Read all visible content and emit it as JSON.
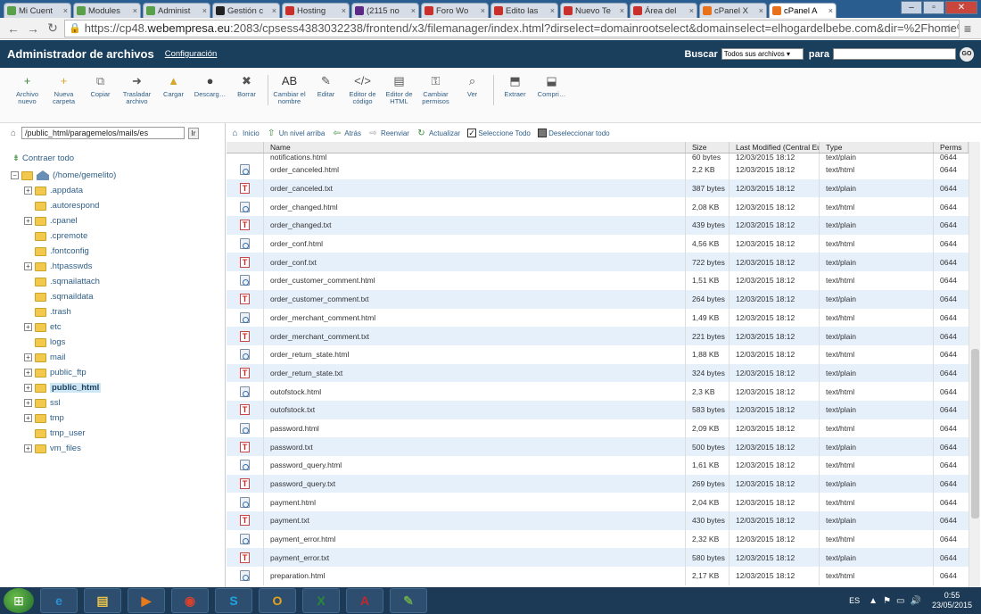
{
  "browser": {
    "tabs": [
      {
        "label": "Mi Cuent",
        "color": "#5aa04a"
      },
      {
        "label": "Modules",
        "color": "#5aa04a"
      },
      {
        "label": "Administ",
        "color": "#5aa04a"
      },
      {
        "label": "Gestión c",
        "color": "#222222"
      },
      {
        "label": "Hosting",
        "color": "#c9302c"
      },
      {
        "label": "(2115 no",
        "color": "#5b2a86"
      },
      {
        "label": "Foro Wo",
        "color": "#c9302c"
      },
      {
        "label": "Edito las",
        "color": "#c9302c"
      },
      {
        "label": "Nuevo Te",
        "color": "#c9302c"
      },
      {
        "label": "Área del",
        "color": "#c9302c"
      },
      {
        "label": "cPanel X",
        "color": "#e8711c"
      },
      {
        "label": "cPanel A",
        "color": "#e8711c",
        "active": true
      }
    ],
    "url_prefix": "https://cp48.",
    "url_domain": "webempresa.eu",
    "url_rest": ":2083/cpsess4383032238/frontend/x3/filemanager/index.html?dirselect=domainrootselect&domainselect=elhogardelbebe.com&dir=%2Fhome%2Fgei"
  },
  "cpanel": {
    "title": "Administrador de archivos",
    "config_link": "Configuración",
    "search_label": "Buscar",
    "search_select": "Todos sus archivos",
    "search_para": "para",
    "go_label": "GO"
  },
  "toolbar": [
    {
      "name": "archivo-nuevo",
      "label": "Archivo nuevo",
      "icon": "+",
      "color": "#3a8a3a"
    },
    {
      "name": "nueva-carpeta",
      "label": "Nueva carpeta",
      "icon": "+",
      "color": "#d4a82a"
    },
    {
      "name": "copiar",
      "label": "Copiar",
      "icon": "⧉",
      "color": "#777"
    },
    {
      "name": "trasladar-archivo",
      "label": "Trasladar archivo",
      "icon": "➜",
      "color": "#555"
    },
    {
      "name": "cargar",
      "label": "Cargar",
      "icon": "▲",
      "color": "#d4a82a"
    },
    {
      "name": "descargar",
      "label": "Descarg…",
      "icon": "●",
      "color": "#444"
    },
    {
      "name": "borrar",
      "label": "Borrar",
      "icon": "✖",
      "color": "#555"
    },
    {
      "name": "cambiar-nombre",
      "label": "Cambiar el nombre",
      "icon": "AB",
      "color": "#333"
    },
    {
      "name": "editar",
      "label": "Editar",
      "icon": "✎",
      "color": "#555"
    },
    {
      "name": "editor-codigo",
      "label": "Editor de código",
      "icon": "</>",
      "color": "#555"
    },
    {
      "name": "editor-html",
      "label": "Editor de HTML",
      "icon": "▤",
      "color": "#555"
    },
    {
      "name": "cambiar-permisos",
      "label": "Cambiar permisos",
      "icon": "⚿",
      "color": "#555"
    },
    {
      "name": "ver",
      "label": "Ver",
      "icon": "⌕",
      "color": "#555"
    },
    {
      "name": "extraer",
      "label": "Extraer",
      "icon": "⬒",
      "color": "#555"
    },
    {
      "name": "comprimir",
      "label": "Compri…",
      "icon": "⬓",
      "color": "#555"
    }
  ],
  "left": {
    "path": "/public_html/paragemelos/mails/es",
    "ir_label": "Ir",
    "collapse_label": "Contraer todo",
    "tree": [
      {
        "label": "(/home/gemelito)",
        "level": 0,
        "plus": true,
        "home": true
      },
      {
        "label": ".appdata",
        "level": 1,
        "plus": true
      },
      {
        "label": ".autorespond",
        "level": 1,
        "plus": false
      },
      {
        "label": ".cpanel",
        "level": 1,
        "plus": true
      },
      {
        "label": ".cpremote",
        "level": 1,
        "plus": false
      },
      {
        "label": ".fontconfig",
        "level": 1,
        "plus": false
      },
      {
        "label": ".htpasswds",
        "level": 1,
        "plus": true
      },
      {
        "label": ".sqmailattach",
        "level": 1,
        "plus": false
      },
      {
        "label": ".sqmaildata",
        "level": 1,
        "plus": false
      },
      {
        "label": ".trash",
        "level": 1,
        "plus": false
      },
      {
        "label": "etc",
        "level": 1,
        "plus": true
      },
      {
        "label": "logs",
        "level": 1,
        "plus": false
      },
      {
        "label": "mail",
        "level": 1,
        "plus": true
      },
      {
        "label": "public_ftp",
        "level": 1,
        "plus": true
      },
      {
        "label": "public_html",
        "level": 1,
        "plus": true,
        "selected": true
      },
      {
        "label": "ssl",
        "level": 1,
        "plus": true
      },
      {
        "label": "tmp",
        "level": 1,
        "plus": true
      },
      {
        "label": "tmp_user",
        "level": 1,
        "plus": false
      },
      {
        "label": "vm_files",
        "level": 1,
        "plus": true
      }
    ]
  },
  "filebar": [
    {
      "name": "inicio",
      "label": "Inicio",
      "icon": "⌂",
      "color": "#2f5e86"
    },
    {
      "name": "nivel-arriba",
      "label": "Un nivel arriba",
      "icon": "⇧",
      "color": "#3a8a3a"
    },
    {
      "name": "atras",
      "label": "Atrás",
      "icon": "⇦",
      "color": "#3a8a3a"
    },
    {
      "name": "reenviar",
      "label": "Reenviar",
      "icon": "⇨",
      "color": "#999"
    },
    {
      "name": "actualizar",
      "label": "Actualizar",
      "icon": "↻",
      "color": "#3a8a3a"
    }
  ],
  "select_all": "Seleccione Todo",
  "deselect_all": "Deseleccionar todo",
  "columns": {
    "name": "Name",
    "size": "Size",
    "modified": "Last Modified (Central Eu",
    "type": "Type",
    "perms": "Perms"
  },
  "partial_row": {
    "name": "notifications.html",
    "size": "60 bytes",
    "modified": "12/03/2015 18:12",
    "type": "text/plain",
    "perms": "0644"
  },
  "files": [
    {
      "name": "order_canceled.html",
      "size": "2,2 KB",
      "modified": "12/03/2015 18:12",
      "type": "text/html",
      "perms": "0644",
      "kind": "html"
    },
    {
      "name": "order_canceled.txt",
      "size": "387 bytes",
      "modified": "12/03/2015 18:12",
      "type": "text/plain",
      "perms": "0644",
      "kind": "txt"
    },
    {
      "name": "order_changed.html",
      "size": "2,08 KB",
      "modified": "12/03/2015 18:12",
      "type": "text/html",
      "perms": "0644",
      "kind": "html"
    },
    {
      "name": "order_changed.txt",
      "size": "439 bytes",
      "modified": "12/03/2015 18:12",
      "type": "text/plain",
      "perms": "0644",
      "kind": "txt"
    },
    {
      "name": "order_conf.html",
      "size": "4,56 KB",
      "modified": "12/03/2015 18:12",
      "type": "text/html",
      "perms": "0644",
      "kind": "html"
    },
    {
      "name": "order_conf.txt",
      "size": "722 bytes",
      "modified": "12/03/2015 18:12",
      "type": "text/plain",
      "perms": "0644",
      "kind": "txt"
    },
    {
      "name": "order_customer_comment.html",
      "size": "1,51 KB",
      "modified": "12/03/2015 18:12",
      "type": "text/html",
      "perms": "0644",
      "kind": "html"
    },
    {
      "name": "order_customer_comment.txt",
      "size": "264 bytes",
      "modified": "12/03/2015 18:12",
      "type": "text/plain",
      "perms": "0644",
      "kind": "txt"
    },
    {
      "name": "order_merchant_comment.html",
      "size": "1,49 KB",
      "modified": "12/03/2015 18:12",
      "type": "text/html",
      "perms": "0644",
      "kind": "html"
    },
    {
      "name": "order_merchant_comment.txt",
      "size": "221 bytes",
      "modified": "12/03/2015 18:12",
      "type": "text/plain",
      "perms": "0644",
      "kind": "txt"
    },
    {
      "name": "order_return_state.html",
      "size": "1,88 KB",
      "modified": "12/03/2015 18:12",
      "type": "text/html",
      "perms": "0644",
      "kind": "html"
    },
    {
      "name": "order_return_state.txt",
      "size": "324 bytes",
      "modified": "12/03/2015 18:12",
      "type": "text/plain",
      "perms": "0644",
      "kind": "txt"
    },
    {
      "name": "outofstock.html",
      "size": "2,3 KB",
      "modified": "12/03/2015 18:12",
      "type": "text/html",
      "perms": "0644",
      "kind": "html"
    },
    {
      "name": "outofstock.txt",
      "size": "583 bytes",
      "modified": "12/03/2015 18:12",
      "type": "text/plain",
      "perms": "0644",
      "kind": "txt"
    },
    {
      "name": "password.html",
      "size": "2,09 KB",
      "modified": "12/03/2015 18:12",
      "type": "text/html",
      "perms": "0644",
      "kind": "html"
    },
    {
      "name": "password.txt",
      "size": "500 bytes",
      "modified": "12/03/2015 18:12",
      "type": "text/plain",
      "perms": "0644",
      "kind": "txt"
    },
    {
      "name": "password_query.html",
      "size": "1,61 KB",
      "modified": "12/03/2015 18:12",
      "type": "text/html",
      "perms": "0644",
      "kind": "html"
    },
    {
      "name": "password_query.txt",
      "size": "269 bytes",
      "modified": "12/03/2015 18:12",
      "type": "text/plain",
      "perms": "0644",
      "kind": "txt"
    },
    {
      "name": "payment.html",
      "size": "2,04 KB",
      "modified": "12/03/2015 18:12",
      "type": "text/html",
      "perms": "0644",
      "kind": "html"
    },
    {
      "name": "payment.txt",
      "size": "430 bytes",
      "modified": "12/03/2015 18:12",
      "type": "text/plain",
      "perms": "0644",
      "kind": "txt"
    },
    {
      "name": "payment_error.html",
      "size": "2,32 KB",
      "modified": "12/03/2015 18:12",
      "type": "text/html",
      "perms": "0644",
      "kind": "html"
    },
    {
      "name": "payment_error.txt",
      "size": "580 bytes",
      "modified": "12/03/2015 18:12",
      "type": "text/plain",
      "perms": "0644",
      "kind": "txt"
    },
    {
      "name": "preparation.html",
      "size": "2,17 KB",
      "modified": "12/03/2015 18:12",
      "type": "text/html",
      "perms": "0644",
      "kind": "html"
    }
  ],
  "taskbar": {
    "apps": [
      {
        "name": "ie",
        "glyph": "e",
        "color": "#2a8fd6"
      },
      {
        "name": "explorer",
        "glyph": "▤",
        "color": "#e8c24a"
      },
      {
        "name": "media",
        "glyph": "▶",
        "color": "#e87a1c"
      },
      {
        "name": "chrome",
        "glyph": "◉",
        "color": "#d9412f"
      },
      {
        "name": "skype",
        "glyph": "S",
        "color": "#1ea4e0"
      },
      {
        "name": "outlook",
        "glyph": "O",
        "color": "#e8a21c"
      },
      {
        "name": "excel",
        "glyph": "X",
        "color": "#2a8a3a"
      },
      {
        "name": "acrobat",
        "glyph": "A",
        "color": "#c8262d"
      },
      {
        "name": "paint",
        "glyph": "✎",
        "color": "#6aa84f"
      }
    ],
    "lang": "ES",
    "time": "0:55",
    "date": "23/05/2015"
  }
}
